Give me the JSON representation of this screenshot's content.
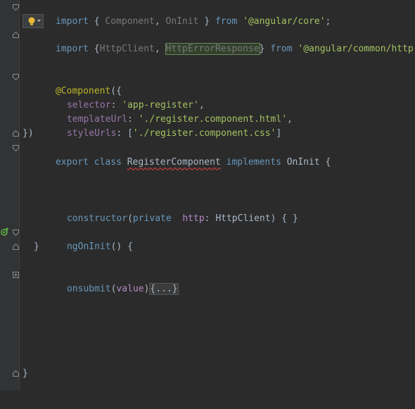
{
  "lines": {
    "l1": {
      "import": "import",
      "open": " { ",
      "component": "Component",
      "comma": ", ",
      "oninit": "OnInit",
      "close": " } ",
      "from": "from",
      "module": " '@angular/core'",
      "semi": ";"
    },
    "l3": {
      "import": "import",
      "open": " {",
      "httpclient": "HttpClient",
      "comma": ", ",
      "httperror": "HttpErrorResponse",
      "close": "} ",
      "from": "from",
      "module": " '@angular/common/http'"
    },
    "l6": {
      "ann": "@Component",
      "rest": "({"
    },
    "l7": {
      "key": "selector",
      "colon": ": ",
      "val": "'app-register'",
      "end": ","
    },
    "l8": {
      "key": "templateUrl",
      "colon": ": ",
      "val": "'./register.component.html'",
      "end": ","
    },
    "l9": {
      "key": "styleUrls",
      "colon": ": ",
      "open": "[",
      "val": "'./register.component.css'",
      "end": "]"
    },
    "l10": {
      "text": "})"
    },
    "l11": {
      "export": "export",
      "class": " class ",
      "name": "RegisterComponent",
      "implements": " implements ",
      "iface": "OnInit",
      "brace": " {"
    },
    "l15": {
      "ctor": "constructor",
      "open": "(",
      "private": "private",
      "sp": "  ",
      "param": "http",
      "colon": ": ",
      "type": "HttpClient",
      "close": ") { }"
    },
    "l17": {
      "fn": "ngOnInit",
      "rest": "() {"
    },
    "l18": {
      "text": "}"
    },
    "l20": {
      "fn": "onsubmit",
      "open": "(",
      "param": "value",
      "close": ")",
      "collapsed": "{...}"
    },
    "l27": {
      "text": "}"
    }
  },
  "icons": {
    "bulb": "lightbulb-icon",
    "fold": "fold-marker-icon",
    "gear": "implements-gutter-icon"
  },
  "colors": {
    "background": "#2b2b2b",
    "gutter": "#313335",
    "keyword": "#6897bb",
    "string": "#a5c261",
    "property": "#9876aa",
    "annotation": "#bbb529",
    "error_underline": "#bc3f3c"
  }
}
